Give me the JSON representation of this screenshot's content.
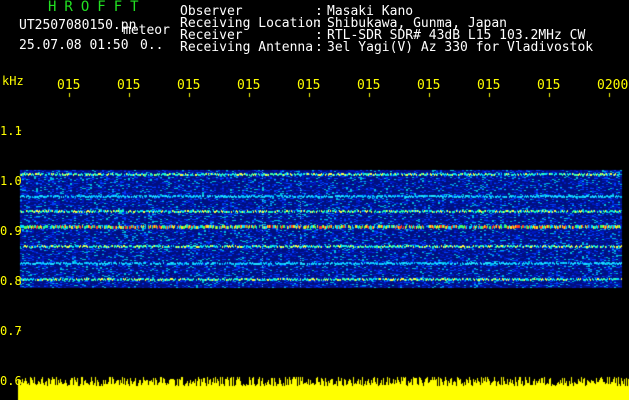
{
  "app": {
    "title": "HROFFT",
    "file_name": "UT2507080150.pn",
    "mode": "meteor",
    "date_time": "25.07.08 01:50",
    "count": "0.."
  },
  "header": {
    "rows": [
      {
        "label": "Observer",
        "value": "Masaki Kano"
      },
      {
        "label": "Receiving Location",
        "value": "Shibukawa, Gunma, Japan"
      },
      {
        "label": "Receiver",
        "value": "RTL-SDR SDR# 43dB L15 103.2MHz CW"
      },
      {
        "label": "Receiving Antenna",
        "value": "3el Yagi(V) Az 330 for Vladivostok"
      }
    ],
    "colon": ":"
  },
  "axis": {
    "y_unit": "kHz",
    "x_ticks": [
      "015",
      "015",
      "015",
      "015",
      "015",
      "015",
      "015",
      "015",
      "015",
      "0200"
    ],
    "y_ticks": [
      "1.1",
      "1.0",
      "0.9",
      "0.8",
      "0.7",
      "0.6"
    ]
  },
  "colors": {
    "background": "#000000",
    "title_text": "#22e022",
    "header_text": "#ffffff",
    "axis_text": "#ffff00",
    "noise_bar": "#ffff00",
    "spectrogram_base": "#0010b0"
  }
}
